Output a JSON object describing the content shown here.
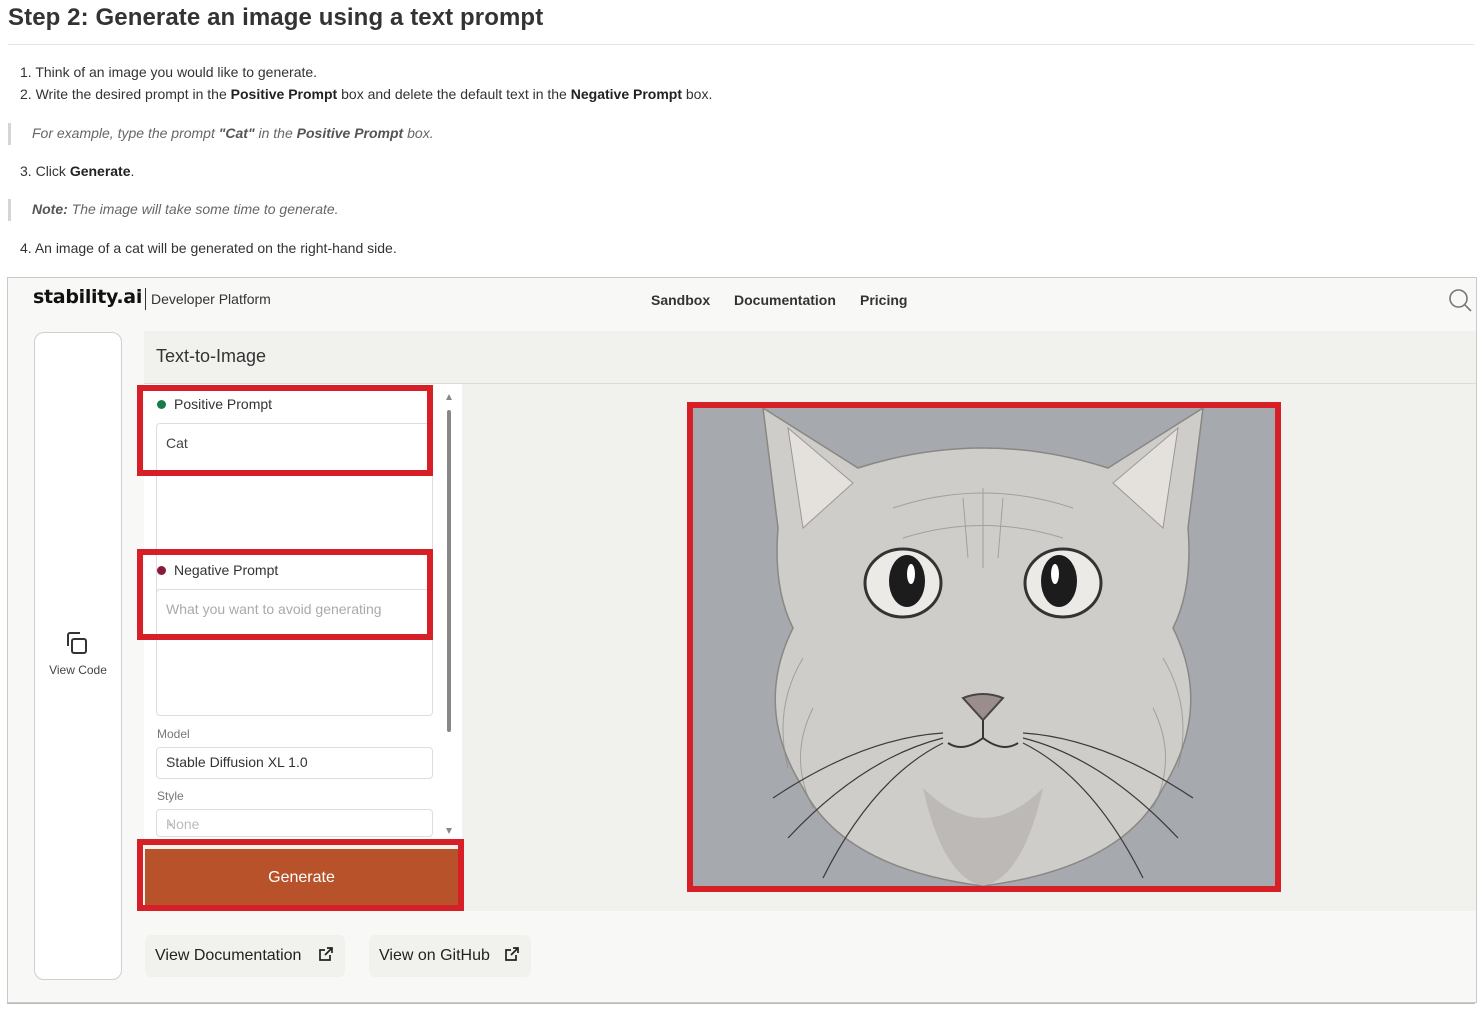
{
  "doc": {
    "heading": "Step 2: Generate an image using a text prompt",
    "steps": {
      "s1": {
        "num": "1.",
        "text": "Think of an image you would like to generate."
      },
      "s2": {
        "num": "2.",
        "pre": "Write the desired prompt in the ",
        "bold1": "Positive Prompt",
        "mid": " box and delete the default text in the ",
        "bold2": "Negative Prompt",
        "post": " box."
      },
      "s3": {
        "num": "3.",
        "pre": "Click ",
        "bold": "Generate",
        "post": "."
      },
      "s4": {
        "num": "4.",
        "text": "An image of a cat will be generated on the right-hand side."
      }
    },
    "quote1": {
      "pre": "For example, type the prompt ",
      "bold1": "\"Cat\"",
      "mid": " in the ",
      "bold2": "Positive Prompt",
      "post": " box."
    },
    "quote2": {
      "bold": "Note:",
      "text": " The image will take some time to generate."
    }
  },
  "app": {
    "logo": "stability.ai",
    "platform": "Developer Platform",
    "nav": [
      "Sandbox",
      "Documentation",
      "Pricing"
    ],
    "view_code": "View Code",
    "panel_title": "Text-to-Image",
    "positive_label": "Positive Prompt",
    "positive_value": "Cat",
    "negative_label": "Negative Prompt",
    "negative_placeholder": "What you want to avoid generating",
    "model_label": "Model",
    "model_value": "Stable Diffusion XL 1.0",
    "style_label": "Style",
    "style_value": "None",
    "generate": "Generate",
    "view_documentation": "View Documentation",
    "view_github": "View on GitHub"
  },
  "colors": {
    "highlight": "#d61f26",
    "generate_bg": "#b8522a",
    "positive_dot": "#1a7a4a",
    "negative_dot": "#8a1a3a"
  },
  "icons": [
    "search-icon",
    "copy-icon",
    "external-link-icon",
    "scroll-up-icon",
    "scroll-down-icon",
    "chevron-down-icon"
  ]
}
